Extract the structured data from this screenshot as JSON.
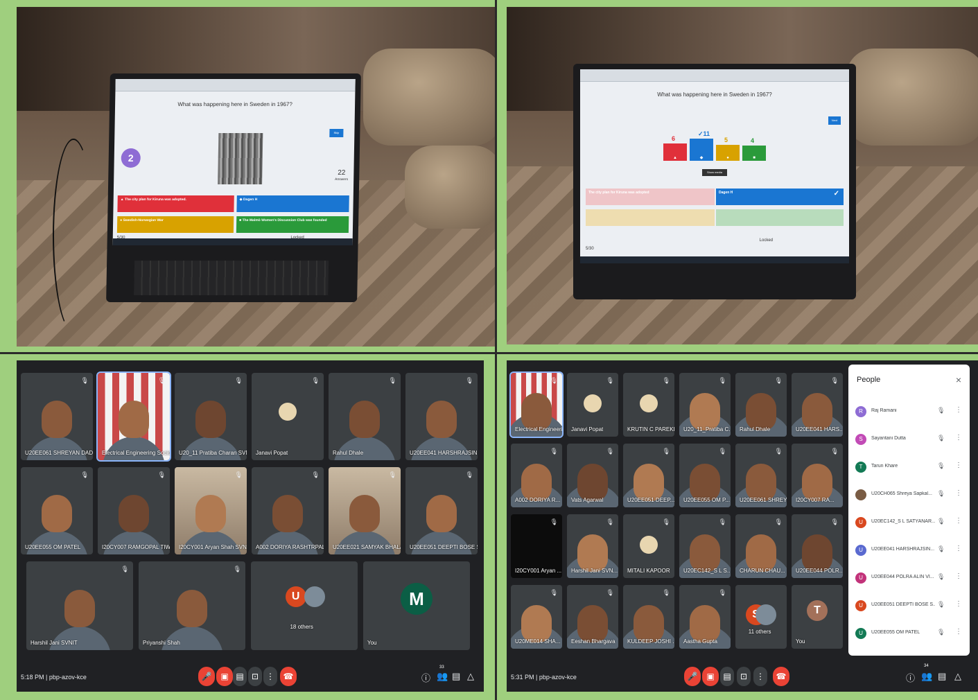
{
  "quiz_photo_1": {
    "question": "What was happening here in Sweden in 1967?",
    "timer": "2",
    "answers_count": "22",
    "answers_label": "Answers",
    "skip_label": "Skip",
    "progress": "5/30",
    "locked": "Locked",
    "answers": [
      {
        "text": "The city plan for Kiruna was adopted.",
        "color": "#e0303a",
        "symbol": "▲"
      },
      {
        "text": "Dagen H",
        "color": "#1a76d2",
        "symbol": "◆"
      },
      {
        "text": "Swedish-Norwegian War",
        "color": "#d8a200",
        "symbol": "●"
      },
      {
        "text": "The Malmö Women's Discussion Club was founded",
        "color": "#2a9a3a",
        "symbol": "■"
      }
    ]
  },
  "quiz_photo_2": {
    "question": "What was happening here in Sweden in 1967?",
    "next_label": "Next",
    "show_media": "Show media",
    "progress": "5/30",
    "locked": "Locked",
    "results": [
      {
        "value": 6,
        "color": "#e0303a",
        "symbol": "▲",
        "correct": false
      },
      {
        "value": 11,
        "color": "#1a76d2",
        "symbol": "◆",
        "correct": true
      },
      {
        "value": 5,
        "color": "#d8a200",
        "symbol": "●",
        "correct": false
      },
      {
        "value": 4,
        "color": "#2a9a3a",
        "symbol": "■",
        "correct": false
      }
    ],
    "correct_mark": "✓",
    "answer_correct": "Dagen H",
    "answer_wrong": "The city plan for Kiruna was adopted"
  },
  "meet_1": {
    "time": "5:18 PM",
    "code": "pbp-azov-kce",
    "participant_count": "33",
    "tiles": [
      {
        "name": "U20EE061 SHREYAN DADHIC...",
        "kind": "video"
      },
      {
        "name": "Electrical Engineering Society",
        "kind": "active"
      },
      {
        "name": "U20_11 Pratiba Charan SVNIT",
        "kind": "video"
      },
      {
        "name": "Janavi Popat",
        "kind": "avatar"
      },
      {
        "name": "Rahul Dhale",
        "kind": "video"
      },
      {
        "name": "U20EE041 HARSHRAJSINH G",
        "kind": "video"
      },
      {
        "name": "U20EE055 OM PATEL",
        "kind": "video"
      },
      {
        "name": "I20CY007 RAMGOPAL TIWAR...",
        "kind": "video"
      },
      {
        "name": "I20CY001 Aryan Shah SVNIT",
        "kind": "bright"
      },
      {
        "name": "A002 DORIYA RASHTRPAL DE...",
        "kind": "video"
      },
      {
        "name": "U20EE021 SAMYAK BHALANI",
        "kind": "bright"
      },
      {
        "name": "U20EE051 DEEPTI BOSE SVNIT",
        "kind": "video"
      },
      {
        "name": "Harshil Jani SVNIT",
        "kind": "video"
      },
      {
        "name": "Priyanshi Shah",
        "kind": "video"
      }
    ],
    "others_label": "18 others",
    "others_avatar": "U",
    "you_avatar": "M",
    "you_label": "You"
  },
  "meet_2": {
    "time": "5:31 PM",
    "code": "pbp-azov-kce",
    "participant_count": "34",
    "tiles": [
      {
        "name": "Electrical Engineeri...",
        "kind": "active"
      },
      {
        "name": "Janavi Popat",
        "kind": "avatar"
      },
      {
        "name": "KRUTIN C PAREKH",
        "kind": "avatar"
      },
      {
        "name": "U20_11_Pratiba C...",
        "kind": "video"
      },
      {
        "name": "Rahul Dhale",
        "kind": "video"
      },
      {
        "name": "U20EE041 HARS...",
        "kind": "video"
      },
      {
        "name": "A002 DORIYA R...",
        "kind": "video"
      },
      {
        "name": "Vats Agarwal",
        "kind": "video"
      },
      {
        "name": "U20EE051 DEEP...",
        "kind": "video"
      },
      {
        "name": "U20EE055 OM P...",
        "kind": "video"
      },
      {
        "name": "U20EE061 SHREY...",
        "kind": "video"
      },
      {
        "name": "I20CY007 RA...",
        "kind": "video"
      },
      {
        "name": "I20CY001 Aryan ...",
        "kind": "dark"
      },
      {
        "name": "Harshil Jani SVN...",
        "kind": "video"
      },
      {
        "name": "MITALI KAPOOR",
        "kind": "avatar"
      },
      {
        "name": "U20EC142_S L S...",
        "kind": "video"
      },
      {
        "name": "CHARUN CHAU...",
        "kind": "video"
      },
      {
        "name": "U20EE044 POLR...",
        "kind": "video"
      },
      {
        "name": "U20ME014 SHA...",
        "kind": "video"
      },
      {
        "name": "Eeshan Bhargava",
        "kind": "video"
      },
      {
        "name": "KULDEEP JOSHI ...",
        "kind": "video"
      },
      {
        "name": "Aastha Gupta",
        "kind": "video"
      }
    ],
    "others_label": "11 others",
    "others_avatar": "S",
    "you_avatar": "T",
    "you_label": "You",
    "people_panel": {
      "title": "People",
      "close": "×",
      "list": [
        {
          "initial": "R",
          "name": "Raj Ramani",
          "color": "#8e6cd4"
        },
        {
          "initial": "S",
          "name": "Sayantani Dutta",
          "color": "#c24bb6"
        },
        {
          "initial": "T",
          "name": "Tarun Khare",
          "color": "#137a55"
        },
        {
          "initial": "",
          "name": "U20CH065 Shreya Sapkal...",
          "color": "#7a5c44"
        },
        {
          "initial": "U",
          "name": "U20EC142_S L SATYANAR...",
          "color": "#d9481f"
        },
        {
          "initial": "U",
          "name": "U20EE041 HARSHRAJSIN...",
          "color": "#5a6ad0"
        },
        {
          "initial": "U",
          "name": "U20EE044 POLRA ALIN VI...",
          "color": "#c2337a"
        },
        {
          "initial": "U",
          "name": "U20EE051 DEEPTI BOSE S...",
          "color": "#d9481f"
        },
        {
          "initial": "U",
          "name": "U20EE055 OM PATEL",
          "color": "#137a55"
        }
      ]
    }
  }
}
